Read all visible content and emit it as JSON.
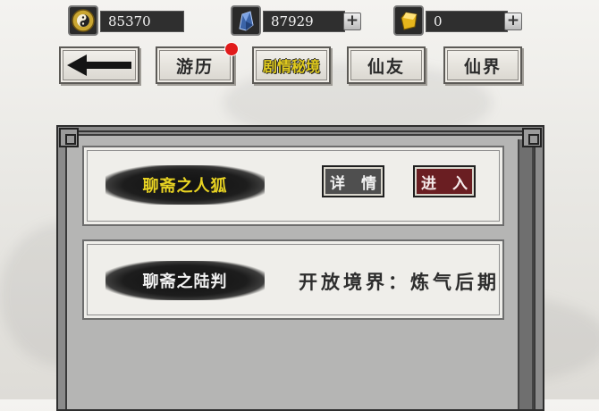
{
  "currencies": [
    {
      "id": "coin",
      "icon": "bagua-coin-icon",
      "value": "85370",
      "has_plus": false
    },
    {
      "id": "crystal",
      "icon": "blue-crystal-icon",
      "value": "87929",
      "has_plus": true
    },
    {
      "id": "gold",
      "icon": "gold-ingot-icon",
      "value": "0",
      "has_plus": true
    }
  ],
  "nav": {
    "back_icon": "back-arrow-icon",
    "tabs": [
      {
        "label": "游历",
        "badge": true
      },
      {
        "label": "剧情秘境",
        "active": true
      },
      {
        "label": "仙友"
      },
      {
        "label": "仙界"
      }
    ]
  },
  "dungeons": [
    {
      "name": "聊斋之人狐",
      "unlocked": true,
      "detail_label": "详 情",
      "enter_label": "进 入"
    },
    {
      "name": "聊斋之陆判",
      "unlocked": false,
      "requirement": "开放境界：炼气后期"
    }
  ],
  "colors": {
    "accent_gold": "#e8d322",
    "enter_red": "#6a1e22",
    "badge_red": "#e11b1b"
  }
}
